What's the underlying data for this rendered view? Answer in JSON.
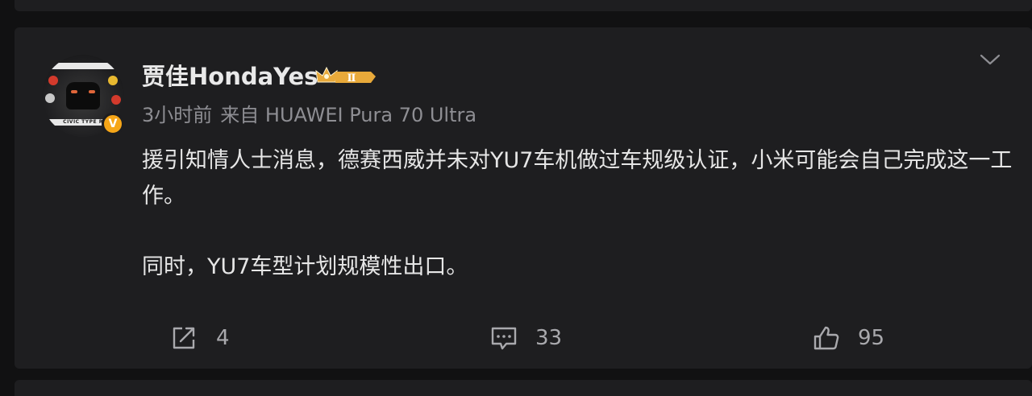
{
  "post": {
    "author": {
      "name": "贾佳HondaYes",
      "level_badge": "Ⅱ",
      "verified_mark": "V",
      "avatar_text": "CIVIC TYPE R"
    },
    "meta": {
      "time": "3小时前",
      "source": "来自 HUAWEI Pura 70 Ultra"
    },
    "content": {
      "paragraph1": "援引知情人士消息，德赛西威并未对YU7车机做过车规级认证，小米可能会自己完成这一工作。",
      "paragraph2": "同时，YU7车型计划规模性出口。"
    },
    "actions": {
      "repost_count": "4",
      "comment_count": "33",
      "like_count": "95"
    },
    "icons": {
      "repost": "share-icon",
      "comment": "comment-icon",
      "like": "thumbs-up-icon",
      "menu": "chevron-down-icon"
    },
    "colors": {
      "background": "#111112",
      "card": "#1e1e20",
      "text_primary": "#e6e6e6",
      "text_secondary": "#8e8e93",
      "verified": "#f6a618",
      "badge_gold": "#e8a93a"
    }
  }
}
